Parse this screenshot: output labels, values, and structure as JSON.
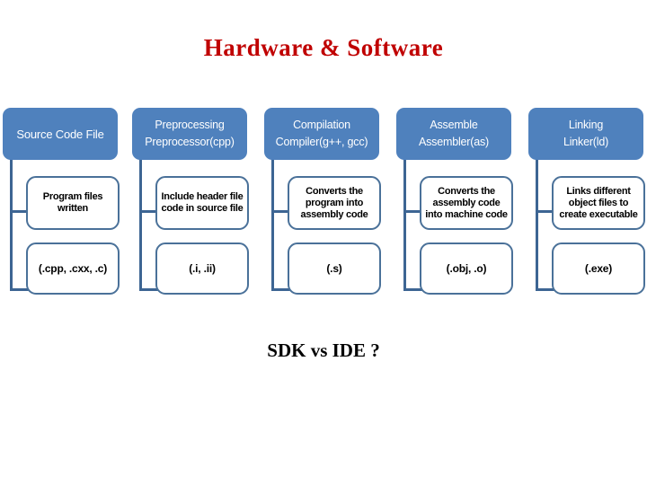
{
  "slide": {
    "title": "Hardware & Software",
    "footer": "SDK vs IDE ?",
    "title_color": "#c00000",
    "header_box_color": "#4f81bd",
    "border_color": "#4a7199",
    "connector_color": "#3d6593",
    "background": "#ffffff"
  },
  "diagram": {
    "columns": [
      {
        "head_line1": "Source Code File",
        "head_line2": "",
        "description": "Program files written",
        "extension": "(.cpp, .cxx, .c)"
      },
      {
        "head_line1": "Preprocessing",
        "head_line2": "Preprocessor(cpp)",
        "description": "Include header file code in source file",
        "extension": "(.i, .ii)"
      },
      {
        "head_line1": "Compilation",
        "head_line2": "Compiler(g++, gcc)",
        "description": "Converts the program into assembly code",
        "extension": "(.s)"
      },
      {
        "head_line1": "Assemble",
        "head_line2": "Assembler(as)",
        "description": "Converts the assembly code into machine code",
        "extension": "(.obj, .o)"
      },
      {
        "head_line1": "Linking",
        "head_line2": "Linker(ld)",
        "description": "Links different object files to create executable",
        "extension": "(.exe)"
      }
    ]
  }
}
